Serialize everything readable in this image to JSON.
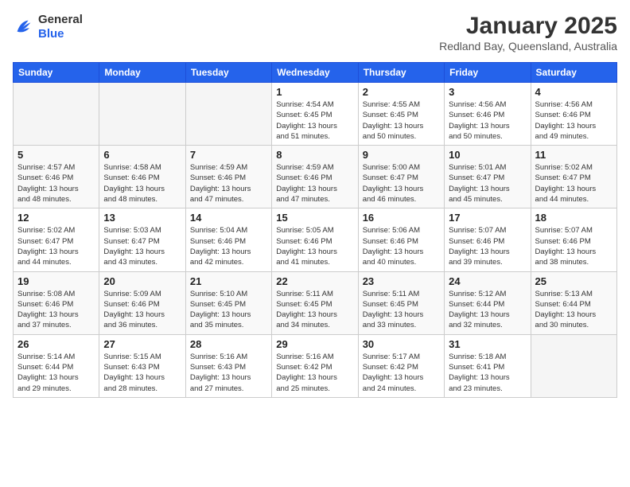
{
  "logo": {
    "general": "General",
    "blue": "Blue"
  },
  "header": {
    "title": "January 2025",
    "location": "Redland Bay, Queensland, Australia"
  },
  "days_of_week": [
    "Sunday",
    "Monday",
    "Tuesday",
    "Wednesday",
    "Thursday",
    "Friday",
    "Saturday"
  ],
  "weeks": [
    [
      {
        "day": "",
        "info": ""
      },
      {
        "day": "",
        "info": ""
      },
      {
        "day": "",
        "info": ""
      },
      {
        "day": "1",
        "info": "Sunrise: 4:54 AM\nSunset: 6:45 PM\nDaylight: 13 hours\nand 51 minutes."
      },
      {
        "day": "2",
        "info": "Sunrise: 4:55 AM\nSunset: 6:45 PM\nDaylight: 13 hours\nand 50 minutes."
      },
      {
        "day": "3",
        "info": "Sunrise: 4:56 AM\nSunset: 6:46 PM\nDaylight: 13 hours\nand 50 minutes."
      },
      {
        "day": "4",
        "info": "Sunrise: 4:56 AM\nSunset: 6:46 PM\nDaylight: 13 hours\nand 49 minutes."
      }
    ],
    [
      {
        "day": "5",
        "info": "Sunrise: 4:57 AM\nSunset: 6:46 PM\nDaylight: 13 hours\nand 48 minutes."
      },
      {
        "day": "6",
        "info": "Sunrise: 4:58 AM\nSunset: 6:46 PM\nDaylight: 13 hours\nand 48 minutes."
      },
      {
        "day": "7",
        "info": "Sunrise: 4:59 AM\nSunset: 6:46 PM\nDaylight: 13 hours\nand 47 minutes."
      },
      {
        "day": "8",
        "info": "Sunrise: 4:59 AM\nSunset: 6:46 PM\nDaylight: 13 hours\nand 47 minutes."
      },
      {
        "day": "9",
        "info": "Sunrise: 5:00 AM\nSunset: 6:47 PM\nDaylight: 13 hours\nand 46 minutes."
      },
      {
        "day": "10",
        "info": "Sunrise: 5:01 AM\nSunset: 6:47 PM\nDaylight: 13 hours\nand 45 minutes."
      },
      {
        "day": "11",
        "info": "Sunrise: 5:02 AM\nSunset: 6:47 PM\nDaylight: 13 hours\nand 44 minutes."
      }
    ],
    [
      {
        "day": "12",
        "info": "Sunrise: 5:02 AM\nSunset: 6:47 PM\nDaylight: 13 hours\nand 44 minutes."
      },
      {
        "day": "13",
        "info": "Sunrise: 5:03 AM\nSunset: 6:47 PM\nDaylight: 13 hours\nand 43 minutes."
      },
      {
        "day": "14",
        "info": "Sunrise: 5:04 AM\nSunset: 6:46 PM\nDaylight: 13 hours\nand 42 minutes."
      },
      {
        "day": "15",
        "info": "Sunrise: 5:05 AM\nSunset: 6:46 PM\nDaylight: 13 hours\nand 41 minutes."
      },
      {
        "day": "16",
        "info": "Sunrise: 5:06 AM\nSunset: 6:46 PM\nDaylight: 13 hours\nand 40 minutes."
      },
      {
        "day": "17",
        "info": "Sunrise: 5:07 AM\nSunset: 6:46 PM\nDaylight: 13 hours\nand 39 minutes."
      },
      {
        "day": "18",
        "info": "Sunrise: 5:07 AM\nSunset: 6:46 PM\nDaylight: 13 hours\nand 38 minutes."
      }
    ],
    [
      {
        "day": "19",
        "info": "Sunrise: 5:08 AM\nSunset: 6:46 PM\nDaylight: 13 hours\nand 37 minutes."
      },
      {
        "day": "20",
        "info": "Sunrise: 5:09 AM\nSunset: 6:46 PM\nDaylight: 13 hours\nand 36 minutes."
      },
      {
        "day": "21",
        "info": "Sunrise: 5:10 AM\nSunset: 6:45 PM\nDaylight: 13 hours\nand 35 minutes."
      },
      {
        "day": "22",
        "info": "Sunrise: 5:11 AM\nSunset: 6:45 PM\nDaylight: 13 hours\nand 34 minutes."
      },
      {
        "day": "23",
        "info": "Sunrise: 5:11 AM\nSunset: 6:45 PM\nDaylight: 13 hours\nand 33 minutes."
      },
      {
        "day": "24",
        "info": "Sunrise: 5:12 AM\nSunset: 6:44 PM\nDaylight: 13 hours\nand 32 minutes."
      },
      {
        "day": "25",
        "info": "Sunrise: 5:13 AM\nSunset: 6:44 PM\nDaylight: 13 hours\nand 30 minutes."
      }
    ],
    [
      {
        "day": "26",
        "info": "Sunrise: 5:14 AM\nSunset: 6:44 PM\nDaylight: 13 hours\nand 29 minutes."
      },
      {
        "day": "27",
        "info": "Sunrise: 5:15 AM\nSunset: 6:43 PM\nDaylight: 13 hours\nand 28 minutes."
      },
      {
        "day": "28",
        "info": "Sunrise: 5:16 AM\nSunset: 6:43 PM\nDaylight: 13 hours\nand 27 minutes."
      },
      {
        "day": "29",
        "info": "Sunrise: 5:16 AM\nSunset: 6:42 PM\nDaylight: 13 hours\nand 25 minutes."
      },
      {
        "day": "30",
        "info": "Sunrise: 5:17 AM\nSunset: 6:42 PM\nDaylight: 13 hours\nand 24 minutes."
      },
      {
        "day": "31",
        "info": "Sunrise: 5:18 AM\nSunset: 6:41 PM\nDaylight: 13 hours\nand 23 minutes."
      },
      {
        "day": "",
        "info": ""
      }
    ]
  ]
}
